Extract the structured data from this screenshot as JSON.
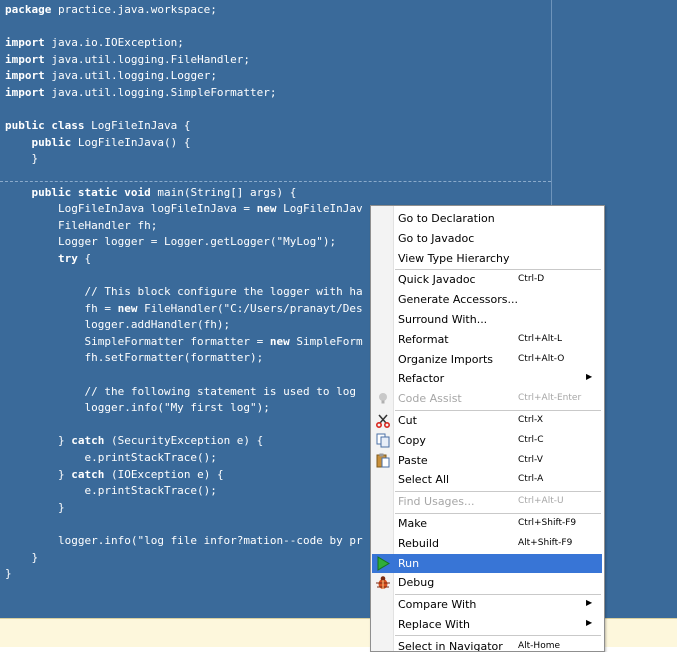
{
  "code_lines": [
    [
      {
        "t": "package",
        "k": true
      },
      {
        "t": " practice.java.workspace;"
      }
    ],
    [],
    [
      {
        "t": "import",
        "k": true
      },
      {
        "t": " java.io.IOException;"
      }
    ],
    [
      {
        "t": "import",
        "k": true
      },
      {
        "t": " java.util.logging.FileHandler;"
      }
    ],
    [
      {
        "t": "import",
        "k": true
      },
      {
        "t": " java.util.logging.Logger;"
      }
    ],
    [
      {
        "t": "import",
        "k": true
      },
      {
        "t": " java.util.logging.SimpleFormatter;"
      }
    ],
    [],
    [
      {
        "t": "public class",
        "k": true
      },
      {
        "t": " LogFileInJava {"
      }
    ],
    [
      {
        "t": "    "
      },
      {
        "t": "public",
        "k": true
      },
      {
        "t": " LogFileInJava() {"
      }
    ],
    [
      {
        "t": "    }"
      }
    ],
    [],
    [
      {
        "t": "    "
      },
      {
        "t": "public static void",
        "k": true
      },
      {
        "t": " main(String[] args) {"
      }
    ],
    [
      {
        "t": "        LogFileInJava logFileInJava = "
      },
      {
        "t": "new",
        "k": true
      },
      {
        "t": " LogFileInJav"
      }
    ],
    [
      {
        "t": "        FileHandler fh;"
      }
    ],
    [
      {
        "t": "        Logger logger = Logger.getLogger(\"MyLog\");"
      }
    ],
    [
      {
        "t": "        "
      },
      {
        "t": "try",
        "k": true
      },
      {
        "t": " {"
      }
    ],
    [],
    [
      {
        "t": "            // This block configure the logger with ha"
      }
    ],
    [
      {
        "t": "            fh = "
      },
      {
        "t": "new",
        "k": true
      },
      {
        "t": " FileHandler(\"C:/Users/pranayt/Des"
      }
    ],
    [
      {
        "t": "            logger.addHandler(fh);"
      }
    ],
    [
      {
        "t": "            SimpleFormatter formatter = "
      },
      {
        "t": "new",
        "k": true
      },
      {
        "t": " SimpleForm"
      }
    ],
    [
      {
        "t": "            fh.setFormatter(formatter);"
      }
    ],
    [],
    [
      {
        "t": "            // the following statement is used to log"
      }
    ],
    [
      {
        "t": "            logger.info(\"My first log\");"
      }
    ],
    [],
    [
      {
        "t": "        } "
      },
      {
        "t": "catch",
        "k": true
      },
      {
        "t": " (SecurityException e) {"
      }
    ],
    [
      {
        "t": "            e.printStackTrace();"
      }
    ],
    [
      {
        "t": "        } "
      },
      {
        "t": "catch",
        "k": true
      },
      {
        "t": " (IOException e) {"
      }
    ],
    [
      {
        "t": "            e.printStackTrace();"
      }
    ],
    [
      {
        "t": "        }"
      }
    ],
    [],
    [
      {
        "t": "        logger.info(\"log file infor?mation--code by pr"
      }
    ],
    [
      {
        "t": "    }"
      }
    ],
    [
      {
        "t": "}"
      }
    ]
  ],
  "menu": {
    "items": [
      {
        "id": "go-to-declaration",
        "label": "Go to Declaration",
        "shortcut": ""
      },
      {
        "id": "go-to-javadoc",
        "label": "Go to Javadoc",
        "shortcut": ""
      },
      {
        "id": "view-type-hierarchy",
        "label": "View Type Hierarchy",
        "shortcut": ""
      },
      {
        "sep": true
      },
      {
        "id": "quick-javadoc",
        "label": "Quick Javadoc",
        "shortcut": "Ctrl-D"
      },
      {
        "id": "generate-accessors",
        "label": "Generate Accessors...",
        "shortcut": ""
      },
      {
        "id": "surround-with",
        "label": "Surround With...",
        "shortcut": ""
      },
      {
        "id": "reformat",
        "label": "Reformat",
        "shortcut": "Ctrl+Alt-L"
      },
      {
        "id": "organize-imports",
        "label": "Organize Imports",
        "shortcut": "Ctrl+Alt-O"
      },
      {
        "id": "refactor",
        "label": "Refactor",
        "shortcut": "",
        "submenu": true
      },
      {
        "id": "code-assist",
        "label": "Code Assist",
        "shortcut": "Ctrl+Alt-Enter",
        "disabled": true,
        "icon": "lightbulb-icon"
      },
      {
        "sep": true
      },
      {
        "id": "cut",
        "label": "Cut",
        "shortcut": "Ctrl-X",
        "icon": "scissors-icon"
      },
      {
        "id": "copy",
        "label": "Copy",
        "shortcut": "Ctrl-C",
        "icon": "copy-icon"
      },
      {
        "id": "paste",
        "label": "Paste",
        "shortcut": "Ctrl-V",
        "icon": "paste-icon"
      },
      {
        "id": "select-all",
        "label": "Select All",
        "shortcut": "Ctrl-A"
      },
      {
        "sep": true
      },
      {
        "id": "find-usages",
        "label": "Find Usages...",
        "shortcut": "Ctrl+Alt-U",
        "disabled": true
      },
      {
        "sep": true
      },
      {
        "id": "make",
        "label": "Make",
        "shortcut": "Ctrl+Shift-F9"
      },
      {
        "id": "rebuild",
        "label": "Rebuild",
        "shortcut": "Alt+Shift-F9"
      },
      {
        "id": "run",
        "label": "Run",
        "shortcut": "",
        "selected": true,
        "icon": "run-icon"
      },
      {
        "id": "debug",
        "label": "Debug",
        "shortcut": "",
        "icon": "debug-icon"
      },
      {
        "sep": true
      },
      {
        "id": "compare-with",
        "label": "Compare With",
        "shortcut": "",
        "submenu": true
      },
      {
        "id": "replace-with",
        "label": "Replace With",
        "shortcut": "",
        "submenu": true
      },
      {
        "sep": true
      },
      {
        "id": "select-in-navigator",
        "label": "Select in Navigator",
        "shortcut": "Alt-Home"
      }
    ],
    "submenu_arrow": "▶"
  },
  "colors": {
    "editor_bg": "#3a6a9a",
    "selected_bg": "#3875d6",
    "disabled_text": "#a6a6a6"
  }
}
